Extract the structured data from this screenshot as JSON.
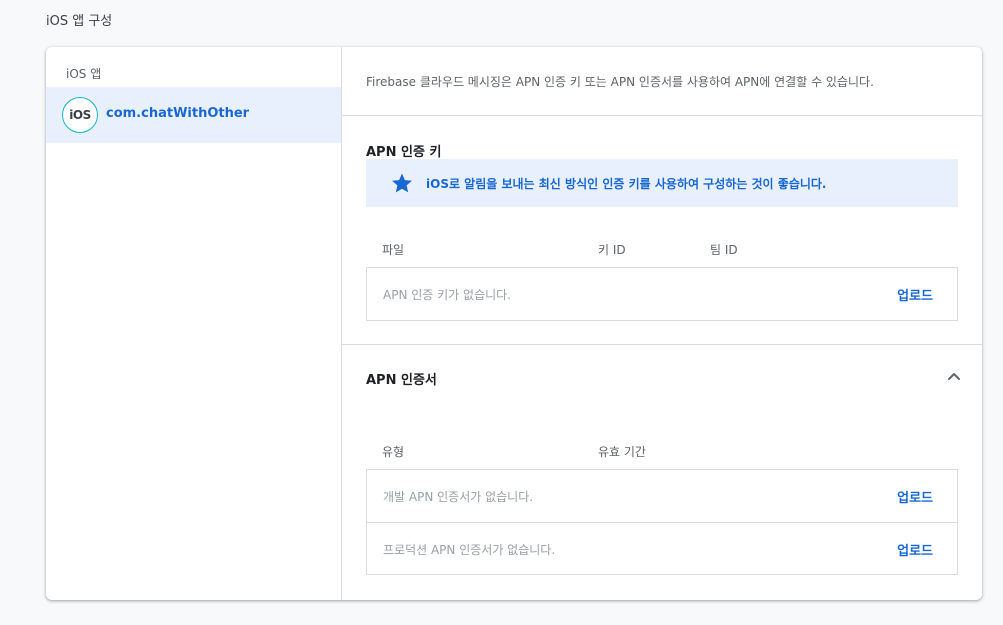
{
  "page": {
    "section_title": "iOS 앱 구성"
  },
  "sidebar": {
    "header": "iOS 앱",
    "apps": [
      {
        "avatar_text": "iOS",
        "name": "com.chatWithOther",
        "selected": true
      }
    ]
  },
  "main": {
    "intro": "Firebase 클라우드 메시징은 APN 인증 키 또는 APN 인증서를 사용하여 APN에 연결할 수 있습니다.",
    "auth_key": {
      "title": "APN 인증 키",
      "tip": {
        "icon": "star-icon",
        "text": "iOS로 알림을 보내는 최신 방식인 인증 키를 사용하여 구성하는 것이 좋습니다."
      },
      "columns": [
        "파일",
        "키 ID",
        "팀 ID"
      ],
      "rows": [
        {
          "text": "APN 인증 키가 없습니다.",
          "action": "업로드"
        }
      ]
    },
    "certificate": {
      "title": "APN 인증서",
      "columns": [
        "유형",
        "유효 기간"
      ],
      "rows": [
        {
          "text": "개발 APN 인증서가 없습니다.",
          "action": "업로드"
        },
        {
          "text": "프로덕션 APN 인증서가 없습니다.",
          "action": "업로드"
        }
      ]
    }
  },
  "colors": {
    "accent": "#1967d2",
    "selected_bg": "#e8f0fe",
    "avatar_ring": "#12b5cb"
  }
}
